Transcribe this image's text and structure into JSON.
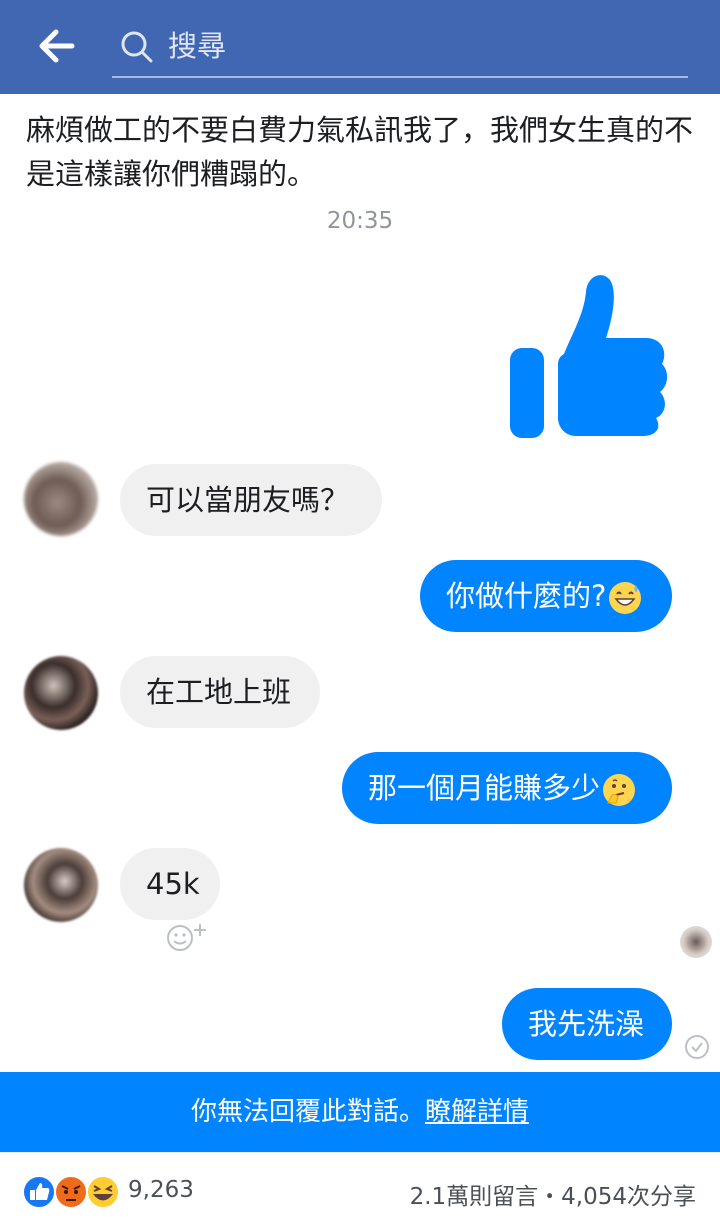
{
  "header": {
    "search_placeholder": "搜尋"
  },
  "post": {
    "text": "麻煩做工的不要白費力氣私訊我了，我們女生真的不是這樣讓你們糟蹋的。"
  },
  "chat": {
    "timestamp": "20:35",
    "messages": [
      {
        "from": "other",
        "text": "可以當朋友嗎？"
      },
      {
        "from": "me",
        "text": "你做什麼的?",
        "emoji": "grinning-sweat"
      },
      {
        "from": "other",
        "text": "在工地上班"
      },
      {
        "from": "me",
        "text": "那一個月能賺多少",
        "emoji": "thinking"
      },
      {
        "from": "other",
        "text": "45k"
      },
      {
        "from": "me",
        "text": "我先洗澡"
      }
    ]
  },
  "blocked_notice": {
    "text": "你無法回覆此對話。",
    "link": "瞭解詳情"
  },
  "footer": {
    "reaction_count": "9,263",
    "engagement": "2.1萬則留言・4,054次分享"
  },
  "colors": {
    "header_bg": "#4267b2",
    "messenger_blue": "#0084ff",
    "incoming_bg": "#f1f0f0"
  },
  "icons": [
    "back-arrow-icon",
    "search-icon",
    "thumbs-up-icon",
    "add-reaction-icon",
    "sent-check-icon",
    "like-icon",
    "angry-icon",
    "haha-icon"
  ]
}
